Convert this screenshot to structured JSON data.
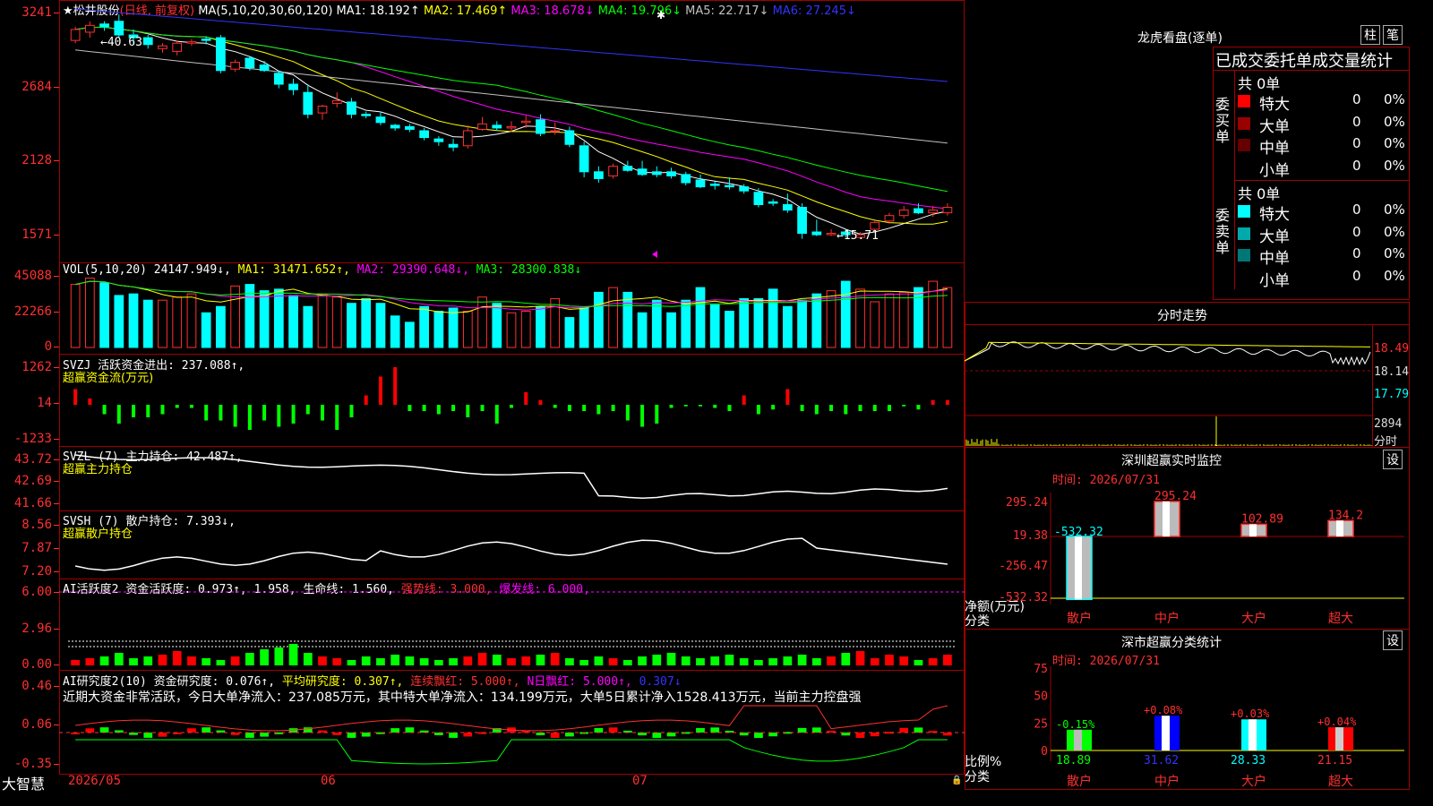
{
  "main_chart": {
    "stock_name": "松井股份",
    "period": "(日线, 前复权)",
    "ma_header": "MA(5,10,20,30,60,120)",
    "ma_items": [
      {
        "label": "MA1: 18.192↑",
        "color": "#ffffff"
      },
      {
        "label": "MA2: 17.469↑",
        "color": "#ffff00"
      },
      {
        "label": "MA3: 18.678↓",
        "color": "#ff00ff"
      },
      {
        "label": "MA4: 19.796↓",
        "color": "#00ff00"
      },
      {
        "label": "MA5: 22.717↓",
        "color": "#c0c0c0"
      },
      {
        "label": "MA6: 27.245↓",
        "color": "#3333ff"
      }
    ],
    "y_ticks": [
      "3241",
      "2684",
      "2128",
      "1571"
    ],
    "high_label": "←40.63",
    "low_label": "←15.71"
  },
  "vol_panel": {
    "title": "VOL(5,10,20)",
    "value": "24147.949↓,",
    "ma1": "MA1: 31471.652↑,",
    "ma2": "MA2: 29390.648↓,",
    "ma3": "MA3: 28300.838↓",
    "y_ticks": [
      "45088",
      "22266",
      "0"
    ]
  },
  "svzj_panel": {
    "title": "SVZJ",
    "desc": "活跃资金进出: 237.088↑,",
    "subtitle": "超赢资金流(万元)",
    "y_ticks": [
      "1262",
      "14",
      "-1233"
    ]
  },
  "svzl_panel": {
    "title": "SVZL (7)",
    "desc": "主力持仓: 42.487↑,",
    "subtitle": "超赢主力持仓",
    "y_ticks": [
      "43.72",
      "42.69",
      "41.66"
    ]
  },
  "svsh_panel": {
    "title": "SVSH (7)",
    "desc": "散户持仓: 7.393↓,",
    "subtitle": "超赢散户持仓",
    "y_ticks": [
      "8.56",
      "7.87",
      "7.20"
    ]
  },
  "ai_active": {
    "title": "AI活跃度2",
    "desc": "资金活跃度: 0.973↑, 1.958,",
    "life": "生命线: 1.560,",
    "strong": "强势线: 3.000,",
    "burst": "爆发线: 6.000,",
    "y_ticks": [
      "6.00",
      "2.96",
      "0.00"
    ]
  },
  "ai_research": {
    "title": "AI研究度2(10)",
    "desc": "资金研究度: 0.076↑,",
    "avg": "平均研究度: 0.307↑,",
    "cont": "连续飘红: 5.000↑,",
    "nday": "N日飘红: 5.000↑,",
    "last": "0.307↓",
    "comment": "近期大资金非常活跃，今日大单净流入：237.085万元，其中特大单净流入：134.199万元，大单5日累计净入1528.413万元，当前主力控盘强",
    "y_ticks": [
      "0.46",
      "0.06",
      "-0.35"
    ]
  },
  "x_axis": {
    "labels": [
      "2026/05",
      "06",
      "07"
    ]
  },
  "brand": "大智慧",
  "right": {
    "lhb_title": "龙虎看盘(逐单)",
    "btn_column": "柱",
    "btn_pen": "笔",
    "stat_title": "已成交委托单成交量统计",
    "buy_label": "委买单",
    "sell_label": "委卖单",
    "buy_total": "共 0单",
    "sell_total": "共 0单",
    "buy_rows": [
      {
        "name": "特大",
        "val": "0",
        "pct": "0%",
        "color": "#ff0000"
      },
      {
        "name": "大单",
        "val": "0",
        "pct": "0%",
        "color": "#990000"
      },
      {
        "name": "中单",
        "val": "0",
        "pct": "0%",
        "color": "#660000"
      },
      {
        "name": "小单",
        "val": "0",
        "pct": "0%",
        "color": ""
      }
    ],
    "sell_rows": [
      {
        "name": "特大",
        "val": "0",
        "pct": "0%",
        "color": "#00ffff"
      },
      {
        "name": "大单",
        "val": "0",
        "pct": "0%",
        "color": "#00aaaa"
      },
      {
        "name": "中单",
        "val": "0",
        "pct": "0%",
        "color": "#007777"
      },
      {
        "name": "小单",
        "val": "0",
        "pct": "0%",
        "color": ""
      }
    ],
    "intraday_title": "分时走势",
    "intraday_ticks": [
      "18.49",
      "18.14",
      "17.79",
      "2894",
      "分时"
    ],
    "sz_monitor_title": "深圳超赢实时监控",
    "time_label": "时间: 2026/07/31",
    "monitor_ticks": [
      "295.24",
      "19.38",
      "-256.47",
      "-532.32"
    ],
    "monitor_values": [
      "-532.32",
      "295.24",
      "102.89",
      "134.2"
    ],
    "monitor_ylabel": "净额(万元)",
    "monitor_xlabel": "分类",
    "categories": [
      "散户",
      "中户",
      "大户",
      "超大"
    ],
    "setting": "设",
    "sz_stat_title": "深市超赢分类统计",
    "stat_time": "时间: 2026/07/31",
    "stat_ticks": [
      "75",
      "50",
      "25",
      "0"
    ],
    "stat_pct": [
      "-0.15%",
      "+0.08%",
      "+0.03%",
      "+0.04%"
    ],
    "stat_values": [
      "18.89",
      "31.62",
      "28.33",
      "21.15"
    ],
    "stat_ylabel": "比例%",
    "stat_xlabel": "分类"
  },
  "chart_data": {
    "type": "candlestick",
    "title": "松井股份 (日线, 前复权)",
    "candles": [
      [
        30.2,
        31.2,
        30.0,
        31.0
      ],
      [
        30.8,
        31.6,
        30.4,
        31.3
      ],
      [
        31.4,
        31.6,
        30.9,
        31.2
      ],
      [
        31.6,
        32.1,
        30.4,
        30.6
      ],
      [
        30.6,
        31.0,
        29.9,
        30.4
      ],
      [
        30.4,
        30.6,
        29.6,
        29.9
      ],
      [
        29.6,
        30.0,
        29.3,
        29.8
      ],
      [
        29.4,
        30.2,
        29.1,
        30.0
      ],
      [
        30.0,
        30.3,
        29.8,
        30.1
      ],
      [
        30.3,
        30.5,
        29.9,
        30.2
      ],
      [
        30.4,
        30.6,
        27.8,
        28.0
      ],
      [
        28.1,
        28.8,
        27.9,
        28.6
      ],
      [
        28.9,
        29.0,
        28.0,
        28.2
      ],
      [
        28.4,
        28.7,
        27.9,
        28.0
      ],
      [
        27.8,
        28.0,
        26.7,
        27.0
      ],
      [
        27.0,
        27.4,
        26.2,
        26.6
      ],
      [
        26.4,
        27.0,
        24.5,
        24.8
      ],
      [
        24.9,
        25.5,
        24.4,
        25.4
      ],
      [
        25.6,
        26.4,
        25.3,
        25.8
      ],
      [
        25.7,
        26.0,
        24.5,
        24.8
      ],
      [
        24.8,
        25.0,
        24.5,
        24.7
      ],
      [
        24.6,
        25.0,
        24.0,
        24.2
      ],
      [
        24.0,
        24.1,
        23.6,
        23.8
      ],
      [
        23.9,
        24.1,
        23.5,
        23.7
      ],
      [
        23.6,
        23.8,
        22.9,
        23.1
      ],
      [
        23.0,
        23.2,
        22.5,
        22.8
      ],
      [
        22.6,
        23.0,
        22.1,
        22.4
      ],
      [
        22.5,
        24.0,
        22.3,
        23.6
      ],
      [
        23.7,
        24.6,
        23.6,
        24.1
      ],
      [
        24.0,
        24.3,
        23.6,
        23.8
      ],
      [
        23.8,
        24.3,
        23.5,
        23.9
      ],
      [
        24.2,
        24.7,
        23.8,
        24.3
      ],
      [
        24.4,
        24.8,
        23.2,
        23.4
      ],
      [
        23.6,
        24.2,
        23.3,
        23.6
      ],
      [
        23.6,
        23.9,
        22.4,
        22.6
      ],
      [
        22.5,
        22.8,
        20.2,
        20.6
      ],
      [
        20.6,
        21.0,
        19.8,
        20.1
      ],
      [
        20.3,
        21.2,
        20.1,
        21.0
      ],
      [
        21.0,
        21.4,
        20.6,
        20.7
      ],
      [
        20.8,
        21.4,
        20.3,
        20.4
      ],
      [
        20.6,
        21.0,
        20.2,
        20.4
      ],
      [
        20.6,
        20.9,
        20.1,
        20.3
      ],
      [
        20.4,
        20.6,
        19.6,
        19.8
      ],
      [
        20.0,
        20.4,
        19.4,
        19.5
      ],
      [
        19.7,
        19.9,
        19.3,
        19.6
      ],
      [
        19.6,
        20.2,
        19.3,
        19.5
      ],
      [
        19.5,
        19.7,
        19.0,
        19.2
      ],
      [
        19.1,
        19.4,
        18.0,
        18.2
      ],
      [
        18.4,
        18.6,
        18.1,
        18.3
      ],
      [
        18.2,
        19.0,
        17.6,
        17.8
      ],
      [
        18.0,
        18.3,
        15.7,
        16.1
      ],
      [
        16.2,
        17.1,
        15.9,
        16.0
      ],
      [
        16.0,
        16.4,
        15.9,
        16.1
      ],
      [
        16.2,
        16.4,
        15.8,
        16.0
      ],
      [
        15.8,
        16.2,
        15.7,
        16.0
      ],
      [
        16.4,
        17.0,
        16.2,
        16.9
      ],
      [
        17.0,
        17.6,
        16.8,
        17.4
      ],
      [
        17.4,
        18.1,
        17.2,
        17.8
      ],
      [
        17.9,
        18.3,
        17.5,
        17.6
      ],
      [
        17.6,
        18.1,
        17.3,
        17.8
      ],
      [
        17.6,
        18.3,
        17.4,
        18.0
      ]
    ],
    "ma_lines": {
      "MA1": 18.192,
      "MA2": 17.469,
      "MA3": 18.678,
      "MA4": 19.796,
      "MA5": 22.717,
      "MA6": 27.245
    },
    "volume": [
      40000,
      44000,
      41000,
      33000,
      34000,
      30000,
      30000,
      32000,
      34000,
      22000,
      26000,
      39000,
      40000,
      36000,
      37000,
      33000,
      26000,
      34000,
      32000,
      28000,
      31000,
      28000,
      20000,
      16000,
      26000,
      23000,
      25000,
      23000,
      32000,
      28000,
      22000,
      23000,
      26000,
      31000,
      19000,
      25000,
      35000,
      38000,
      35000,
      22000,
      30000,
      22000,
      30000,
      38000,
      27000,
      23000,
      31000,
      31000,
      37000,
      26000,
      30000,
      34000,
      36000,
      42000,
      37000,
      29000,
      34000,
      35000,
      38000,
      42000,
      38000,
      31000,
      33000,
      27000
    ],
    "y_range": [
      15.71,
      40.63
    ],
    "x_labels": [
      "2026/05",
      "06",
      "07"
    ]
  }
}
